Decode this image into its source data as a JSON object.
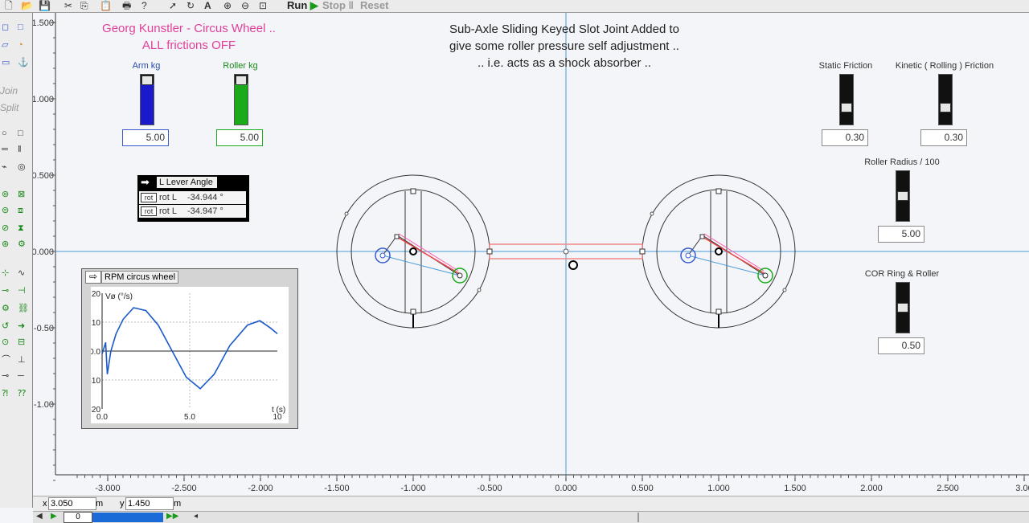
{
  "toolbar": {
    "run": "Run",
    "stop": "Stop",
    "reset": "Reset"
  },
  "sidebar": {
    "join": "Join",
    "split": "Split"
  },
  "notes": {
    "pink_title": [
      "Georg Kunstler - Circus Wheel ..",
      "ALL frictions OFF"
    ],
    "description": [
      "Sub-Axle Sliding Keyed Slot Joint Added to",
      "give some roller pressure self adjustment ..",
      ".. i.e. acts as a shock absorber .."
    ]
  },
  "controls": {
    "arm": {
      "label": "Arm kg",
      "value": "5.00",
      "level": 0.82,
      "color": "#1a1acc"
    },
    "roller": {
      "label": "Roller kg",
      "value": "5.00",
      "level": 0.82,
      "color": "#1aaa1a"
    },
    "static_friction": {
      "label": "Static Friction",
      "value": "0.30",
      "level": 0.3
    },
    "kinetic_friction": {
      "label": "Kinetic ( Rolling ) Friction",
      "value": "0.30",
      "level": 0.3
    },
    "roller_radius": {
      "label": "Roller Radius / 100",
      "value": "5.00",
      "level": 0.5
    },
    "cor": {
      "label": "COR Ring & Roller",
      "value": "0.50",
      "level": 0.5
    }
  },
  "meter": {
    "title": "L Lever Angle",
    "rows": [
      {
        "tag": "rot",
        "label": "rot L",
        "value": "-34.944 °"
      },
      {
        "tag": "rot",
        "label": "rot L",
        "value": "-34.947 °"
      }
    ]
  },
  "graph": {
    "title": "RPM circus wheel",
    "ylabel": "Vø (°/s)",
    "xlabel": "t (s)"
  },
  "chart_data": {
    "type": "line",
    "title": "RPM circus wheel",
    "xlabel": "t (s)",
    "ylabel": "Vø (°/s)",
    "xlim": [
      0,
      10
    ],
    "ylim": [
      -20,
      20
    ],
    "x_ticks": [
      "0.0",
      "5.0",
      "10"
    ],
    "y_ticks": [
      "20",
      "10",
      "0.0",
      "-10",
      "-20"
    ],
    "series": [
      {
        "values": [
          [
            0,
            -1
          ],
          [
            0.2,
            3
          ],
          [
            0.3,
            -8
          ],
          [
            0.4,
            -4
          ],
          [
            0.5,
            0
          ],
          [
            0.8,
            6
          ],
          [
            1.2,
            11
          ],
          [
            1.8,
            15
          ],
          [
            2.5,
            14
          ],
          [
            3.2,
            9
          ],
          [
            4,
            0
          ],
          [
            4.8,
            -9
          ],
          [
            5.6,
            -13
          ],
          [
            6.4,
            -8
          ],
          [
            7.3,
            2
          ],
          [
            8.3,
            9
          ],
          [
            9,
            10.5
          ],
          [
            9.6,
            8
          ],
          [
            10,
            6
          ]
        ]
      }
    ]
  },
  "axes": {
    "x_ticks": [
      "-3.000",
      "-2.500",
      "-2.000",
      "-1.500",
      "-1.000",
      "-0.500",
      "0.000",
      "0.500",
      "1.000",
      "1.500",
      "2.000",
      "2.500",
      "3.00"
    ],
    "y_ticks": [
      "1.500",
      "1.000",
      "0.500",
      "0.000",
      "-0.50",
      "-1.00"
    ]
  },
  "status": {
    "x_label": "x",
    "x_value": "3.050",
    "x_unit": "m",
    "y_label": "y",
    "y_value": "1.450",
    "y_unit": "m",
    "frame": "0"
  }
}
